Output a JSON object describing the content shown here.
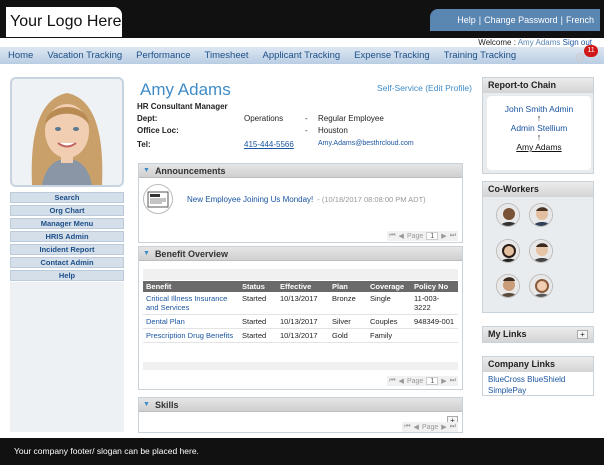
{
  "header": {
    "logo_text": "Your Logo Here",
    "links": [
      "Help",
      "Change Password",
      "French"
    ],
    "separator": "|",
    "welcome_prefix": "Welcome :",
    "user_name": "Amy Adams",
    "sign_out": "Sign out",
    "notifications_count": "11"
  },
  "nav": {
    "items": [
      "Home",
      "Vacation Tracking",
      "Performance",
      "Timesheet",
      "Applicant Tracking",
      "Expense Tracking",
      "Training Tracking"
    ]
  },
  "left_menu": {
    "items": [
      "Search",
      "Org Chart",
      "Manager Menu",
      "HRIS Admin",
      "Incident Report",
      "Contact Admin",
      "Help"
    ]
  },
  "profile": {
    "name": "Amy Adams",
    "self_service": "Self-Service (Edit Profile)",
    "title": "HR Consultant Manager",
    "dept_label": "Dept:",
    "dept_value": "Operations",
    "dash": "-",
    "employee_type": "Regular Employee",
    "office_label": "Office Loc:",
    "office_value": "Houston",
    "tel_label": "Tel:",
    "tel_value": "415-444-5566",
    "email": "Amy.Adams@besthrcloud.com"
  },
  "announcements": {
    "title": "Announcements",
    "items": [
      {
        "title": "New Employee Joining Us Monday!",
        "date": "- (10/18/2017 08:08:00 PM ADT)"
      }
    ],
    "pager": {
      "page_label": "Page",
      "page": "1"
    }
  },
  "benefits": {
    "title": "Benefit Overview",
    "columns": [
      "Benefit",
      "Status",
      "Effective",
      "Plan",
      "Coverage",
      "Policy No"
    ],
    "rows": [
      [
        "Critical Illness Insurance and Services",
        "Started",
        "10/13/2017",
        "Bronze",
        "Single",
        "11-003-3222"
      ],
      [
        "Dental Plan",
        "Started",
        "10/13/2017",
        "Silver",
        "Couples",
        "948349-001"
      ],
      [
        "Prescription Drug Benefits",
        "Started",
        "10/13/2017",
        "Gold",
        "Family",
        ""
      ]
    ],
    "pager": {
      "page_label": "Page",
      "page": "1"
    }
  },
  "skills": {
    "title": "Skills",
    "add_label": "+",
    "pager": {
      "page_label": "Page"
    }
  },
  "report_to": {
    "title": "Report-to Chain",
    "chain": [
      "John Smith Admin",
      "Admin Stellium",
      "Amy Adams"
    ],
    "arrow": "↑"
  },
  "coworkers": {
    "title": "Co-Workers"
  },
  "my_links": {
    "title": "My Links",
    "add_label": "+"
  },
  "company_links": {
    "title": "Company Links",
    "items": [
      "BlueCross BlueShield",
      "SimplePay"
    ]
  },
  "footer": {
    "text": "Your company footer/ slogan can be placed here."
  },
  "colors": {
    "accent_blue": "#3f8cc9",
    "link_blue": "#1b55a0",
    "nav_bg": "#b9cde3",
    "header_bg": "#111111",
    "badge_red": "#d01818"
  },
  "icons": {
    "gear": "gear-icon",
    "collapse": "triangle-down-icon",
    "pager_first": "first-page-icon",
    "pager_prev": "prev-page-icon",
    "pager_next": "next-page-icon",
    "pager_last": "last-page-icon"
  }
}
